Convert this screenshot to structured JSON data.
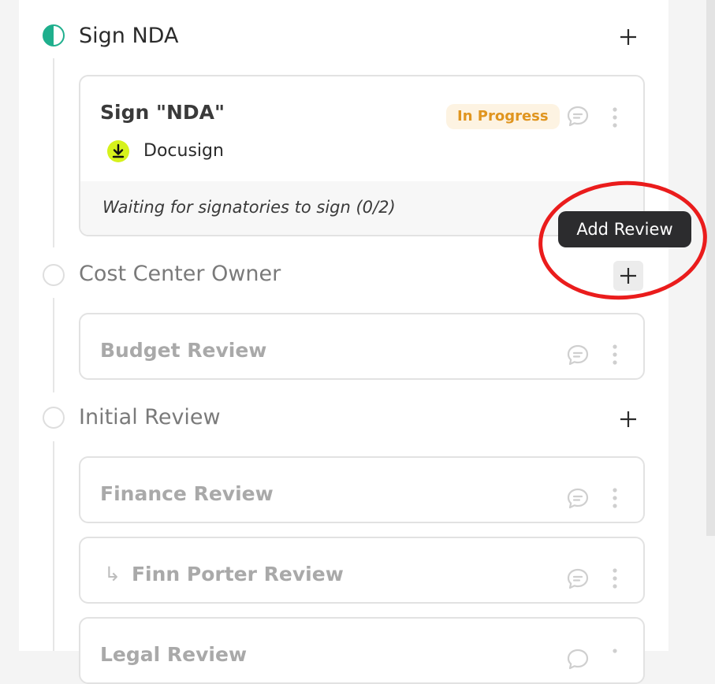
{
  "sections": [
    {
      "title": "Sign NDA",
      "status": "half-complete"
    },
    {
      "title": "Cost Center Owner",
      "status": "pending"
    },
    {
      "title": "Initial Review",
      "status": "pending"
    }
  ],
  "sign_card": {
    "title": "Sign \"NDA\"",
    "badge": "In Progress",
    "provider": "Docusign",
    "footer": "Waiting for signatories to sign (0/2)"
  },
  "cards": {
    "budget": "Budget Review",
    "finance": "Finance Review",
    "finn_arrow": "↳",
    "finn": "Finn Porter Review",
    "legal": "Legal Review"
  },
  "tooltip": "Add Review",
  "icons": {
    "plus": "plus-icon",
    "chat": "chat-bubble-icon",
    "kebab": "more-vertical-icon",
    "download": "download-icon"
  },
  "colors": {
    "accent_green": "#1faf8d",
    "badge_text": "#e0951f",
    "badge_bg": "#fdf3e2",
    "highlight_red": "#ea1c1c",
    "docusign_yellow": "#d6f21c"
  }
}
